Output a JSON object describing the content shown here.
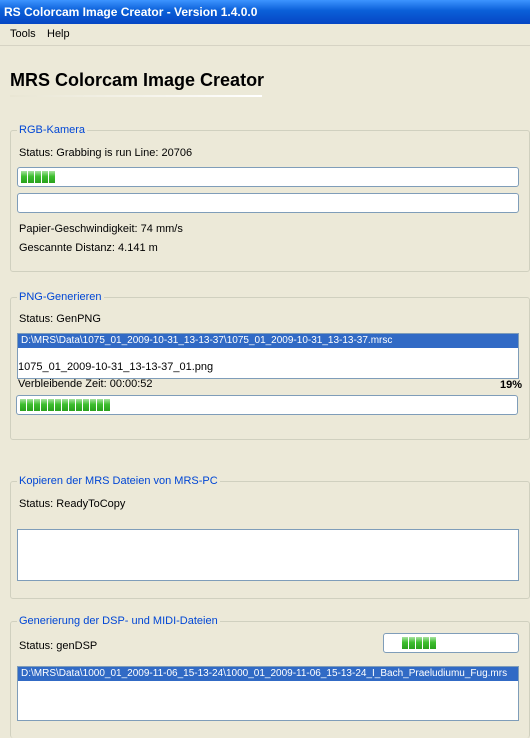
{
  "window": {
    "title": "RS Colorcam Image Creator - Version 1.4.0.0"
  },
  "menu": {
    "tools": "Tools",
    "help": "Help"
  },
  "app_title": "MRS Colorcam Image Creator",
  "rgb_group": {
    "legend": "RGB-Kamera",
    "status": "Status: Grabbing is run Line: 20706",
    "progress1_segments": 5,
    "progress2_segments": 0,
    "speed": "Papier-Geschwindigkeit: 74 mm/s",
    "distance": "Gescannte Distanz: 4.141 m"
  },
  "png_group": {
    "legend": "PNG-Generieren",
    "status": "Status: GenPNG",
    "list_items": [
      "D:\\MRS\\Data\\1075_01_2009-10-31_13-13-37\\1075_01_2009-10-31_13-13-37.mrsc"
    ],
    "current_file": "1075_01_2009-10-31_13-13-37_01.png",
    "remaining": "Verbleibende Zeit: 00:00:52",
    "percent": "19%",
    "progress": 0.19
  },
  "copy_group": {
    "legend": "Kopieren der MRS Dateien von MRS-PC",
    "status": "Status: ReadyToCopy"
  },
  "dsp_group": {
    "legend": "Generierung der DSP- und MIDI-Dateien",
    "status": "Status: genDSP",
    "progress_segments": 5,
    "list_items": [
      "D:\\MRS\\Data\\1000_01_2009-11-06_15-13-24\\1000_01_2009-11-06_15-13-24_I_Bach_Praeludiumu_Fug.mrs"
    ]
  }
}
